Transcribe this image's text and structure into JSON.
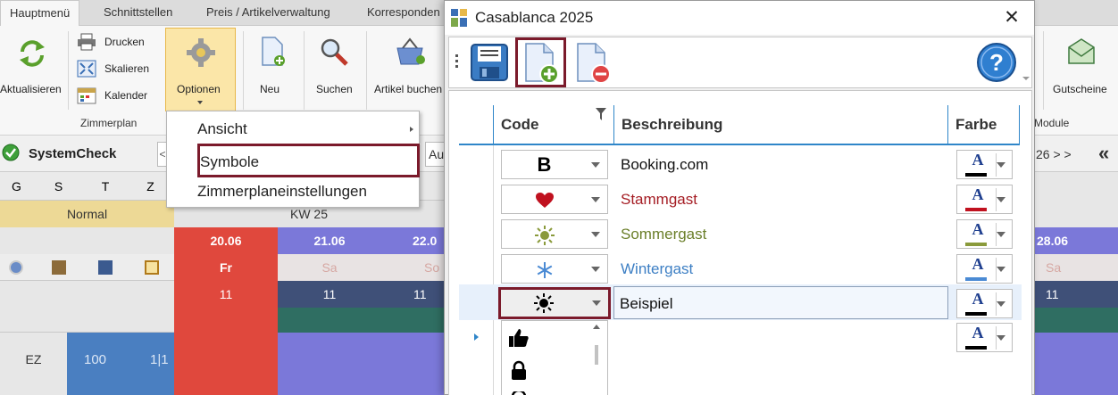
{
  "ribbon": {
    "tabs": [
      "Hauptmenü",
      "Schnittstellen",
      "Preis / Artikelverwaltung",
      "Korresponden"
    ],
    "aktualisieren": "Aktualisieren",
    "drucken": "Drucken",
    "skalieren": "Skalieren",
    "kalender": "Kalender",
    "optionen": "Optionen",
    "neu": "Neu",
    "suchen": "Suchen",
    "artikel_buchen": "Artikel buchen",
    "gutscheine": "Gutscheine",
    "group_zimmerplan": "Zimmerplan",
    "group_module": "Module"
  },
  "options_menu": {
    "items": [
      "Ansicht",
      "Symbole",
      "Zimmerplaneinstellungen"
    ]
  },
  "plan": {
    "systemcheck": "SystemCheck",
    "nav_prev": "<",
    "aus_label": "Au",
    "date_nav": "26 > >",
    "far_nav": "«",
    "weekday_headers": [
      "G",
      "S",
      "T",
      "Z"
    ],
    "normal_label": "Normal",
    "week_label": "KW 25",
    "dates": [
      "20.06",
      "21.06",
      "22.0",
      "28.06"
    ],
    "days": [
      "Fr",
      "Sa",
      "So",
      "Sa"
    ],
    "counts": [
      "11",
      "11",
      "11",
      "11"
    ],
    "room_type": "EZ",
    "room_number": "100",
    "room_ratio": "1|1"
  },
  "dialog": {
    "title": "Casablanca 2025",
    "close": "✕",
    "columns": {
      "code": "Code",
      "beschreibung": "Beschreibung",
      "farbe": "Farbe"
    },
    "rows": [
      {
        "symbol": "B",
        "description": "Booking.com",
        "color": "#000000",
        "text_color": "#111111"
      },
      {
        "symbol": "heart-icon",
        "description": "Stammgast",
        "color": "#c0111f",
        "text_color": "#a51d24"
      },
      {
        "symbol": "sun-icon",
        "description": "Sommergast",
        "color": "#8a9a3b",
        "text_color": "#6b7f2a"
      },
      {
        "symbol": "snowflake-icon",
        "description": "Wintergast",
        "color": "#4a8ad4",
        "text_color": "#3d7fc4"
      },
      {
        "symbol": "sun-black-icon",
        "description": "Beispiel",
        "color": "#000000",
        "text_color": "#111111"
      }
    ],
    "color_glyph": "A",
    "new_row_color": "#000000",
    "dropdown_symbols": [
      "thumbs-up-icon",
      "lock-icon",
      "person-icon"
    ]
  },
  "colors": {
    "accent_red": "#7b1a2b",
    "grid_blue": "#2f86c9",
    "plan_red": "#e0483d",
    "plan_purple": "#7b78d9",
    "plan_teal": "#2f6e62",
    "plan_navy": "#3f5078"
  }
}
